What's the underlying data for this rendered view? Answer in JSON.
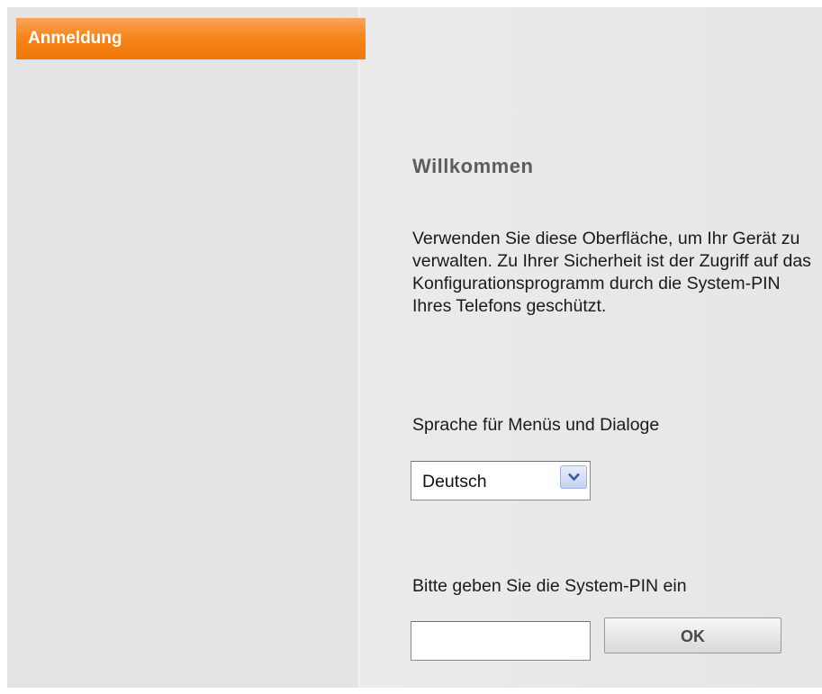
{
  "nav": {
    "items": [
      {
        "label": "Anmeldung",
        "active": true
      }
    ]
  },
  "main": {
    "title": "Willkommen",
    "intro": "Verwenden Sie diese Oberfläche, um Ihr Gerät zu verwalten. Zu Ihrer Sicherheit ist der Zugriff auf das Konfigurationsprogramm durch die System-PIN Ihres Telefons geschützt.",
    "language": {
      "label": "Sprache für Menüs und Dialoge",
      "selected": "Deutsch",
      "icon": "chevron-down-icon"
    },
    "pin": {
      "label": "Bitte geben Sie die System-PIN ein",
      "value": "",
      "placeholder": ""
    },
    "ok_label": "OK"
  },
  "colors": {
    "accent": "#f6861d",
    "background": "#eaeaea",
    "title_text": "#5d5d5d"
  }
}
